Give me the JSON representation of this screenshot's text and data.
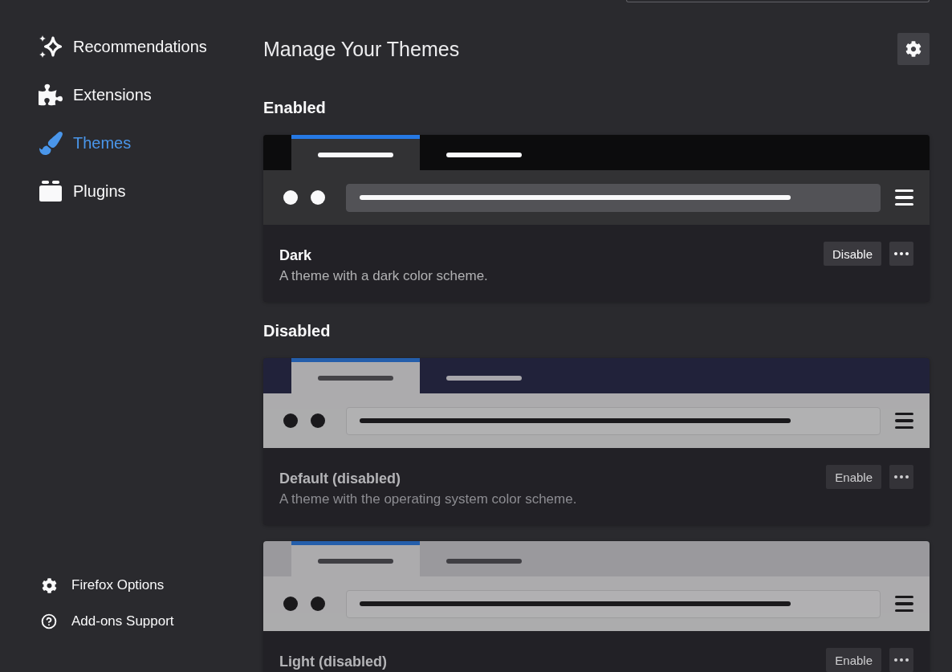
{
  "sidebar": {
    "items": [
      {
        "label": "Recommendations",
        "selected": false
      },
      {
        "label": "Extensions",
        "selected": false
      },
      {
        "label": "Themes",
        "selected": true
      },
      {
        "label": "Plugins",
        "selected": false
      }
    ],
    "footer_links": [
      {
        "label": "Firefox Options"
      },
      {
        "label": "Add-ons Support"
      }
    ]
  },
  "page": {
    "title": "Manage Your Themes"
  },
  "sections": [
    {
      "heading": "Enabled",
      "themes": [
        {
          "kind": "dark",
          "name": "Dark",
          "description": "A theme with a dark color scheme.",
          "disabled": false,
          "action": "Disable"
        }
      ]
    },
    {
      "heading": "Disabled",
      "themes": [
        {
          "kind": "default",
          "name": "Default (disabled)",
          "description": "A theme with the operating system color scheme.",
          "disabled": true,
          "action": "Enable"
        },
        {
          "kind": "light",
          "name": "Light (disabled)",
          "disabled": true,
          "action": "Enable"
        }
      ]
    }
  ]
}
